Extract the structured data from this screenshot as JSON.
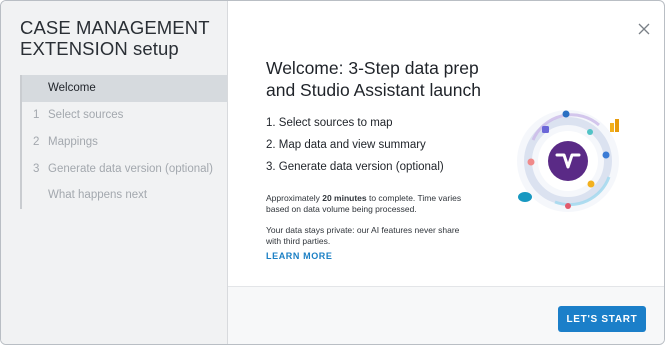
{
  "sidebar": {
    "title_line1": "CASE MANAGEMENT",
    "title_line2": "EXTENSION setup",
    "steps": [
      {
        "number": "",
        "label": "Welcome",
        "active": true
      },
      {
        "number": "1",
        "label": "Select sources",
        "active": false
      },
      {
        "number": "2",
        "label": "Mappings",
        "active": false
      },
      {
        "number": "3",
        "label": "Generate data version (optional)",
        "active": false
      },
      {
        "number": "",
        "label": "What happens next",
        "active": false
      }
    ]
  },
  "main": {
    "title_line1": "Welcome: 3-Step data prep",
    "title_line2": "and Studio Assistant launch",
    "list": [
      "1. Select sources to map",
      "2. Map data and view summary",
      "3. Generate data version (optional)"
    ],
    "time_prefix": "Approximately ",
    "time_bold": "20 minutes",
    "time_suffix_line1": " to complete. Time varies",
    "time_line2": "based on data volume being processed.",
    "privacy_line1": "Your data stays private: our AI features never share",
    "privacy_line2": "with third parties.",
    "learn_more": "LEARN MORE",
    "close_icon": "close-icon",
    "hero_icon": "studio-assistant-orbit-icon"
  },
  "footer": {
    "start_label": "LET'S START"
  },
  "colors": {
    "accent": "#1b7fc9",
    "link": "#1a7fc4",
    "hero_center": "#5a2a86",
    "active_step_bg": "#d6dade"
  }
}
